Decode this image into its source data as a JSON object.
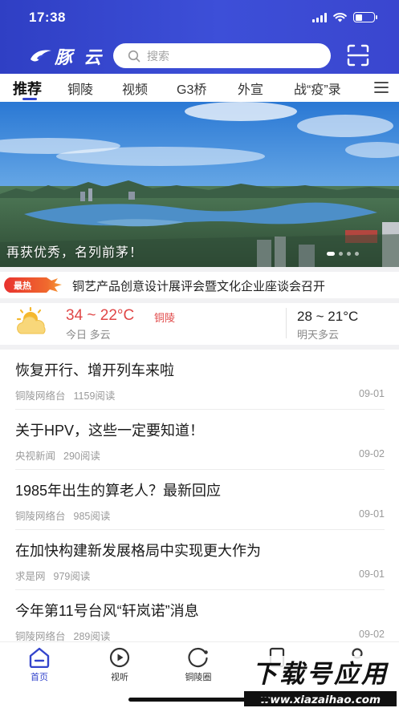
{
  "status_bar": {
    "time": "17:38"
  },
  "header": {
    "logo_text": "豚 云",
    "search_placeholder": "搜索"
  },
  "tabs": [
    {
      "label": "推荐",
      "active": true
    },
    {
      "label": "铜陵"
    },
    {
      "label": "视频"
    },
    {
      "label": "G3桥"
    },
    {
      "label": "外宣"
    },
    {
      "label": "战“疫”录"
    }
  ],
  "banner": {
    "caption": "再获优秀，名列前茅！"
  },
  "hot_news": {
    "badge": "最热",
    "text": "铜艺产品创意设计展评会暨文化企业座谈会召开"
  },
  "weather": {
    "today_temp": "34 ~ 22°C",
    "city": "铜陵",
    "today_desc": "今日 多云",
    "tomorrow_temp": "28 ~ 21°C",
    "tomorrow_desc": "明天多云"
  },
  "news": [
    {
      "title": "恢复开行、增开列车来啦",
      "source": "铜陵网络台",
      "reads": "1159阅读",
      "date": "09-01"
    },
    {
      "title": "关于HPV，这些一定要知道！",
      "source": "央视新闻",
      "reads": "290阅读",
      "date": "09-02"
    },
    {
      "title": "1985年出生的算老人？最新回应",
      "source": "铜陵网络台",
      "reads": "985阅读",
      "date": "09-01"
    },
    {
      "title": "在加快构建新发展格局中实现更大作为",
      "source": "求是网",
      "reads": "979阅读",
      "date": "09-01"
    },
    {
      "title": "今年第11号台风“轩岚诺”消息",
      "source": "铜陵网络台",
      "reads": "289阅读",
      "date": "09-02"
    }
  ],
  "bottom_nav": [
    {
      "label": "首页",
      "active": true
    },
    {
      "label": "视听"
    },
    {
      "label": "铜陵圈"
    }
  ],
  "watermark": {
    "line1": "下载号应用",
    "line2": "www.xiazaihao.com"
  },
  "colors": {
    "brand": "#3344cc",
    "hot": "#e03c3c",
    "temp": "#e04747"
  }
}
